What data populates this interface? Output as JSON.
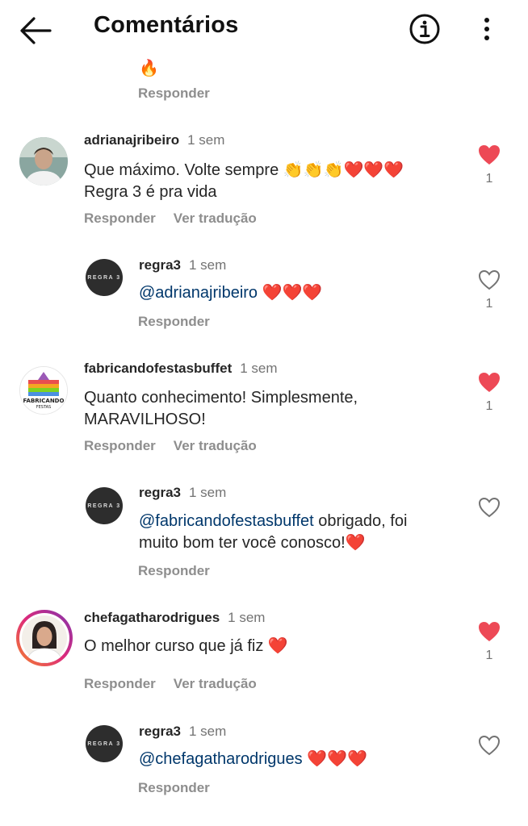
{
  "header": {
    "title": "Comentários"
  },
  "top_partial": {
    "emoji": "🔥",
    "reply_label": "Responder"
  },
  "comments": [
    {
      "username": "adrianajribeiro",
      "time": "1 sem",
      "text_line1": "Que máximo. Volte sempre 👏👏👏❤️❤️❤️",
      "text_line2": "Regra 3 é pra vida",
      "reply_label": "Responder",
      "translate_label": "Ver tradução",
      "likes": "1",
      "liked": true,
      "reply": {
        "username": "regra3",
        "time": "1 sem",
        "mention": "@adrianajribeiro",
        "text": " ❤️❤️❤️",
        "reply_label": "Responder",
        "avatar_text": "REGRA 3"
      }
    },
    {
      "username": "fabricandofestasbuffet",
      "time": "1 sem",
      "text_line1": "Quanto conhecimento! Simplesmente,",
      "text_line2": "MARAVILHOSO!",
      "reply_label": "Responder",
      "translate_label": "Ver tradução",
      "likes": "1",
      "liked": true,
      "reply": {
        "username": "regra3",
        "time": "1 sem",
        "mention": "@fabricandofestasbuffet",
        "text": " obrigado, foi",
        "text_line2": "muito bom ter você conosco!❤️",
        "reply_label": "Responder",
        "avatar_text": "REGRA 3"
      }
    },
    {
      "username": "chefagatharodrigues",
      "time": "1 sem",
      "text_line1": "O melhor curso que já fiz ❤️",
      "reply_label": "Responder",
      "translate_label": "Ver tradução",
      "likes": "1",
      "liked": true,
      "reply": {
        "username": "regra3",
        "time": "1 sem",
        "mention": "@chefagatharodrigues",
        "text": " ❤️❤️❤️",
        "reply_label": "Responder",
        "avatar_text": "REGRA 3"
      }
    }
  ],
  "colors": {
    "like_red": "#ed4956",
    "mention_blue": "#00376b",
    "secondary_gray": "#737373"
  }
}
